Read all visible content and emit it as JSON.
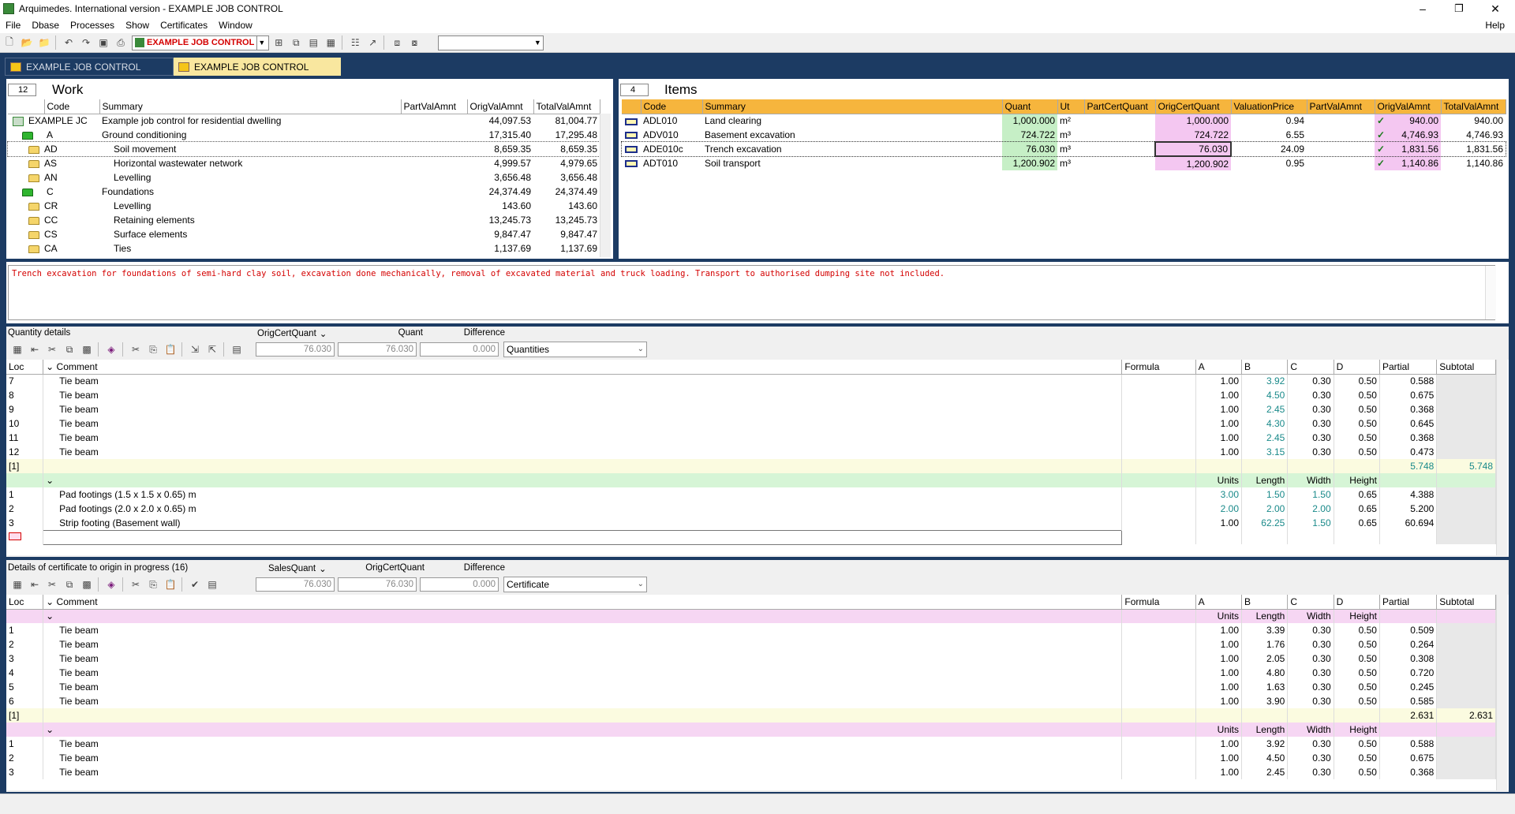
{
  "window": {
    "title": "Arquimedes. International version - EXAMPLE JOB CONTROL",
    "minimize": "–",
    "maximize": "❐",
    "close": "✕"
  },
  "menu": {
    "items": [
      "File",
      "Dbase",
      "Processes",
      "Show",
      "Certificates",
      "Window"
    ],
    "help": "Help"
  },
  "toolbar": {
    "job_selector": "EXAMPLE JOB CONTROL"
  },
  "tabs": [
    {
      "label": "EXAMPLE JOB CONTROL"
    },
    {
      "label": "EXAMPLE JOB CONTROL"
    }
  ],
  "work": {
    "count": "12",
    "title": "Work",
    "columns": [
      "Code",
      "Summary",
      "PartValAmnt",
      "OrigValAmnt",
      "TotalValAmnt"
    ],
    "rows": [
      {
        "code": "EXAMPLE JC",
        "summary": "Example job control for residential dwelling",
        "part": "",
        "orig": "44,097.53",
        "total": "81,004.77"
      },
      {
        "code": "A",
        "summary": "Ground conditioning",
        "part": "",
        "orig": "17,315.40",
        "total": "17,295.48"
      },
      {
        "code": "AD",
        "summary": "Soil movement",
        "part": "",
        "orig": "8,659.35",
        "total": "8,659.35"
      },
      {
        "code": "AS",
        "summary": "Horizontal wastewater network",
        "part": "",
        "orig": "4,999.57",
        "total": "4,979.65"
      },
      {
        "code": "AN",
        "summary": "Levelling",
        "part": "",
        "orig": "3,656.48",
        "total": "3,656.48"
      },
      {
        "code": "C",
        "summary": "Foundations",
        "part": "",
        "orig": "24,374.49",
        "total": "24,374.49"
      },
      {
        "code": "CR",
        "summary": "Levelling",
        "part": "",
        "orig": "143.60",
        "total": "143.60"
      },
      {
        "code": "CC",
        "summary": "Retaining elements",
        "part": "",
        "orig": "13,245.73",
        "total": "13,245.73"
      },
      {
        "code": "CS",
        "summary": "Surface elements",
        "part": "",
        "orig": "9,847.47",
        "total": "9,847.47"
      },
      {
        "code": "CA",
        "summary": "Ties",
        "part": "",
        "orig": "1,137.69",
        "total": "1,137.69"
      }
    ]
  },
  "items": {
    "count": "4",
    "title": "Items",
    "columns": [
      "Code",
      "Summary",
      "Quant",
      "Ut",
      "PartCertQuant",
      "OrigCertQuant",
      "ValuationPrice",
      "PartValAmnt",
      "OrigValAmnt",
      "TotalValAmnt"
    ],
    "rows": [
      {
        "code": "ADL010",
        "summary": "Land clearing",
        "quant": "1,000.000",
        "ut": "m²",
        "partcert": "",
        "origcert": "1,000.000",
        "price": "0.94",
        "partval": "",
        "origval": "940.00",
        "total": "940.00"
      },
      {
        "code": "ADV010",
        "summary": "Basement excavation",
        "quant": "724.722",
        "ut": "m³",
        "partcert": "",
        "origcert": "724.722",
        "price": "6.55",
        "partval": "",
        "origval": "4,746.93",
        "total": "4,746.93"
      },
      {
        "code": "ADE010c",
        "summary": "Trench excavation",
        "quant": "76.030",
        "ut": "m³",
        "partcert": "",
        "origcert": "76.030",
        "price": "24.09",
        "partval": "",
        "origval": "1,831.56",
        "total": "1,831.56"
      },
      {
        "code": "ADT010",
        "summary": "Soil transport",
        "quant": "1,200.902",
        "ut": "m³",
        "partcert": "",
        "origcert": "1,200.902",
        "price": "0.95",
        "partval": "",
        "origval": "1,140.86",
        "total": "1,140.86"
      }
    ]
  },
  "description": "Trench excavation for foundations of semi-hard clay soil, excavation done mechanically, removal of excavated material and truck loading. Transport to authorised dumping site not included.",
  "quantity_details": {
    "title": "Quantity details",
    "label_a": "OrigCertQuant",
    "label_b": "Quant",
    "label_c": "Difference",
    "val_a": "76.030",
    "val_b": "76.030",
    "val_c": "0.000",
    "select": "Quantities",
    "columns": [
      "Loc",
      "Comment",
      "Formula",
      "A",
      "B",
      "C",
      "D",
      "Partial",
      "Subtotal"
    ],
    "subheader": [
      "Units",
      "Length",
      "Width",
      "Height"
    ],
    "rows1": [
      {
        "loc": "7",
        "comment": "Tie beam",
        "a": "1.00",
        "b": "3.92",
        "c": "0.30",
        "d": "0.50",
        "partial": "0.588"
      },
      {
        "loc": "8",
        "comment": "Tie beam",
        "a": "1.00",
        "b": "4.50",
        "c": "0.30",
        "d": "0.50",
        "partial": "0.675"
      },
      {
        "loc": "9",
        "comment": "Tie beam",
        "a": "1.00",
        "b": "2.45",
        "c": "0.30",
        "d": "0.50",
        "partial": "0.368"
      },
      {
        "loc": "10",
        "comment": "Tie beam",
        "a": "1.00",
        "b": "4.30",
        "c": "0.30",
        "d": "0.50",
        "partial": "0.645"
      },
      {
        "loc": "11",
        "comment": "Tie beam",
        "a": "1.00",
        "b": "2.45",
        "c": "0.30",
        "d": "0.50",
        "partial": "0.368"
      },
      {
        "loc": "12",
        "comment": "Tie beam",
        "a": "1.00",
        "b": "3.15",
        "c": "0.30",
        "d": "0.50",
        "partial": "0.473"
      }
    ],
    "subtotal1": {
      "loc": "[1]",
      "partial": "5.748",
      "subtotal": "5.748"
    },
    "rows2": [
      {
        "loc": "1",
        "comment": "Pad footings (1.5 x 1.5 x 0.65) m",
        "a": "3.00",
        "b": "1.50",
        "c": "1.50",
        "d": "0.65",
        "partial": "4.388"
      },
      {
        "loc": "2",
        "comment": "Pad footings (2.0 x 2.0 x 0.65) m",
        "a": "2.00",
        "b": "2.00",
        "c": "2.00",
        "d": "0.65",
        "partial": "5.200"
      },
      {
        "loc": "3",
        "comment": "Strip footing (Basement wall)",
        "a": "1.00",
        "b": "62.25",
        "c": "1.50",
        "d": "0.65",
        "partial": "60.694"
      }
    ]
  },
  "cert_details": {
    "title": "Details of certificate to origin in progress (16)",
    "label_a": "SalesQuant",
    "label_b": "OrigCertQuant",
    "label_c": "Difference",
    "val_a": "76.030",
    "val_b": "76.030",
    "val_c": "0.000",
    "select": "Certificate",
    "columns": [
      "Loc",
      "Comment",
      "Formula",
      "A",
      "B",
      "C",
      "D",
      "Partial",
      "Subtotal"
    ],
    "subheader": [
      "Units",
      "Length",
      "Width",
      "Height"
    ],
    "rows1": [
      {
        "loc": "1",
        "comment": "Tie beam",
        "a": "1.00",
        "b": "3.39",
        "c": "0.30",
        "d": "0.50",
        "partial": "0.509"
      },
      {
        "loc": "2",
        "comment": "Tie beam",
        "a": "1.00",
        "b": "1.76",
        "c": "0.30",
        "d": "0.50",
        "partial": "0.264"
      },
      {
        "loc": "3",
        "comment": "Tie beam",
        "a": "1.00",
        "b": "2.05",
        "c": "0.30",
        "d": "0.50",
        "partial": "0.308"
      },
      {
        "loc": "4",
        "comment": "Tie beam",
        "a": "1.00",
        "b": "4.80",
        "c": "0.30",
        "d": "0.50",
        "partial": "0.720"
      },
      {
        "loc": "5",
        "comment": "Tie beam",
        "a": "1.00",
        "b": "1.63",
        "c": "0.30",
        "d": "0.50",
        "partial": "0.245"
      },
      {
        "loc": "6",
        "comment": "Tie beam",
        "a": "1.00",
        "b": "3.90",
        "c": "0.30",
        "d": "0.50",
        "partial": "0.585"
      }
    ],
    "subtotal1": {
      "loc": "[1]",
      "partial": "2.631",
      "subtotal": "2.631"
    },
    "rows2": [
      {
        "loc": "1",
        "comment": "Tie beam",
        "a": "1.00",
        "b": "3.92",
        "c": "0.30",
        "d": "0.50",
        "partial": "0.588"
      },
      {
        "loc": "2",
        "comment": "Tie beam",
        "a": "1.00",
        "b": "4.50",
        "c": "0.30",
        "d": "0.50",
        "partial": "0.675"
      },
      {
        "loc": "3",
        "comment": "Tie beam",
        "a": "1.00",
        "b": "2.45",
        "c": "0.30",
        "d": "0.50",
        "partial": "0.368"
      }
    ]
  }
}
